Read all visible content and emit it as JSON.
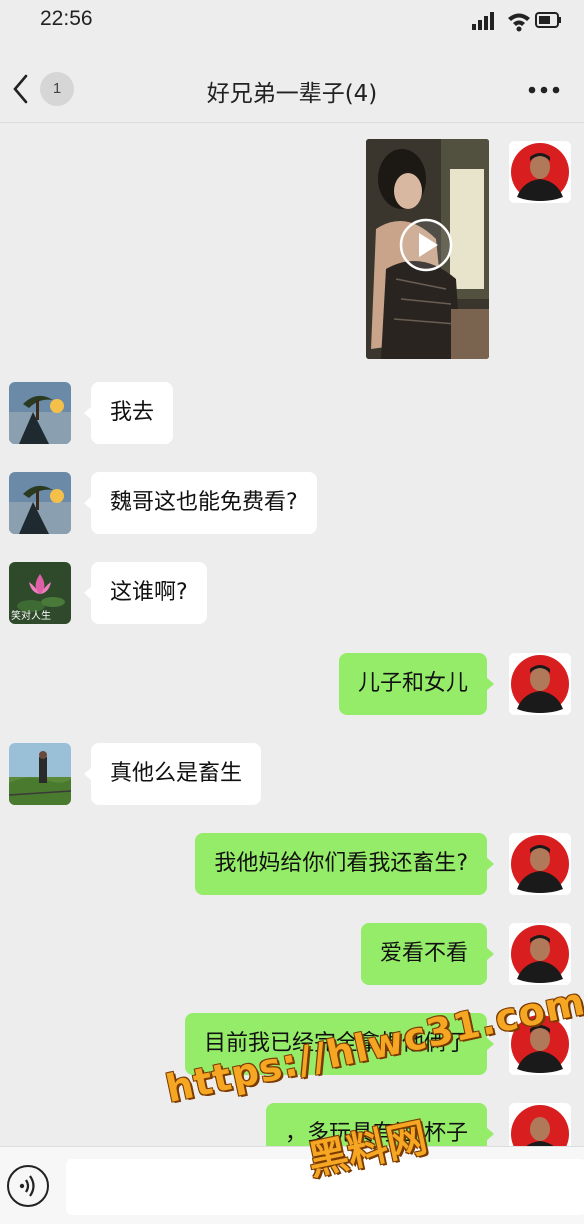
{
  "status": {
    "time": "22:56"
  },
  "header": {
    "back_badge": "1",
    "title": "好兄弟一辈子(4)"
  },
  "messages": [
    {
      "side": "right",
      "type": "video",
      "sender": "self"
    },
    {
      "side": "left",
      "text": "我去",
      "sender": "friend-pine"
    },
    {
      "side": "left",
      "text": "魏哥这也能免费看?",
      "sender": "friend-pine"
    },
    {
      "side": "left",
      "text": "这谁啊?",
      "sender": "friend-lotus",
      "avatar_caption": "笑对人生"
    },
    {
      "side": "right",
      "text": "儿子和女儿",
      "sender": "self"
    },
    {
      "side": "left",
      "text": "真他么是畜生",
      "sender": "friend-field"
    },
    {
      "side": "right",
      "text": "我他妈给你们看我还畜生?",
      "sender": "self"
    },
    {
      "side": "right",
      "text": "爱看不看",
      "sender": "self"
    },
    {
      "side": "right",
      "text": "目前我已经完全拿捏他俩了",
      "sender": "self"
    }
  ],
  "partial_message": {
    "text": "，多玩具有酒 杯子"
  },
  "input": {
    "placeholder": ""
  },
  "watermark": {
    "url": "https://hlwc31.com",
    "label": "黑料网"
  },
  "colors": {
    "background": "#ededed",
    "self_bubble": "#95ec69",
    "other_bubble": "#ffffff",
    "watermark": "#f5a623"
  },
  "icons": [
    "back-icon",
    "more-icon",
    "play-icon",
    "voice-icon",
    "signal-icon",
    "wifi-icon",
    "battery-icon"
  ]
}
